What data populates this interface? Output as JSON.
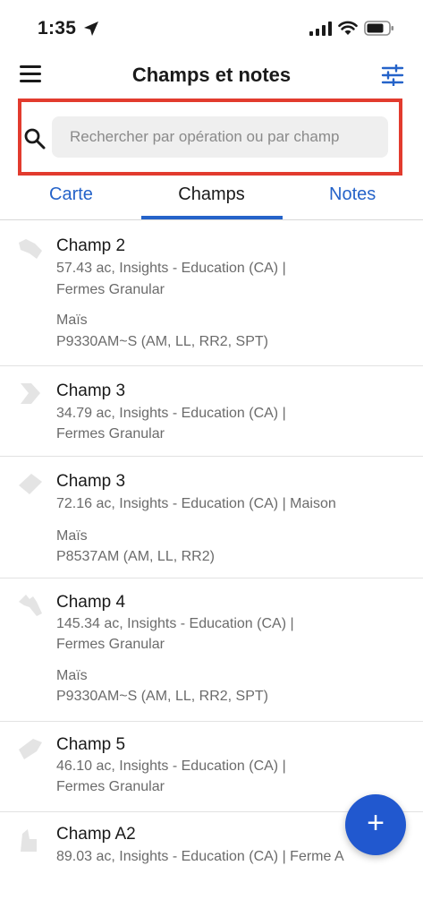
{
  "status_bar": {
    "time": "1:35"
  },
  "header": {
    "title": "Champs et notes",
    "icons": {
      "menu": "hamburger-icon",
      "filter": "sliders-icon"
    }
  },
  "search": {
    "placeholder": "Rechercher par opération ou par champ",
    "value": "",
    "icon": "search-icon"
  },
  "tabs": [
    {
      "label": "Carte",
      "active": false
    },
    {
      "label": "Champs",
      "active": true
    },
    {
      "label": "Notes",
      "active": false
    }
  ],
  "fields": [
    {
      "name": "Champ 2",
      "info_line1": "57.43 ac, Insights - Education (CA) |",
      "info_line2": "Fermes Granular",
      "crop": "Maïs",
      "variety": "P9330AM~S (AM, LL, RR2, SPT)"
    },
    {
      "name": "Champ 3",
      "info_line1": "34.79 ac, Insights - Education (CA) |",
      "info_line2": "Fermes Granular"
    },
    {
      "name": "Champ 3",
      "info_line1": "72.16 ac, Insights - Education (CA) | Maison",
      "crop": "Maïs",
      "variety": "P8537AM (AM, LL, RR2)"
    },
    {
      "name": "Champ 4",
      "info_line1": "145.34 ac, Insights - Education (CA) |",
      "info_line2": "Fermes Granular",
      "crop": "Maïs",
      "variety": "P9330AM~S (AM, LL, RR2, SPT)"
    },
    {
      "name": "Champ 5",
      "info_line1": "46.10 ac, Insights - Education (CA) |",
      "info_line2": "Fermes Granular"
    },
    {
      "name": "Champ A2",
      "info_line1": "89.03 ac, Insights - Education (CA) | Ferme A"
    }
  ],
  "fab": {
    "label": "+"
  },
  "colors": {
    "accent": "#2563c9",
    "fab": "#2158cf",
    "highlight_border": "#e23b2e",
    "search_bg": "#efefef",
    "field_shape": "#e4e4e4"
  }
}
